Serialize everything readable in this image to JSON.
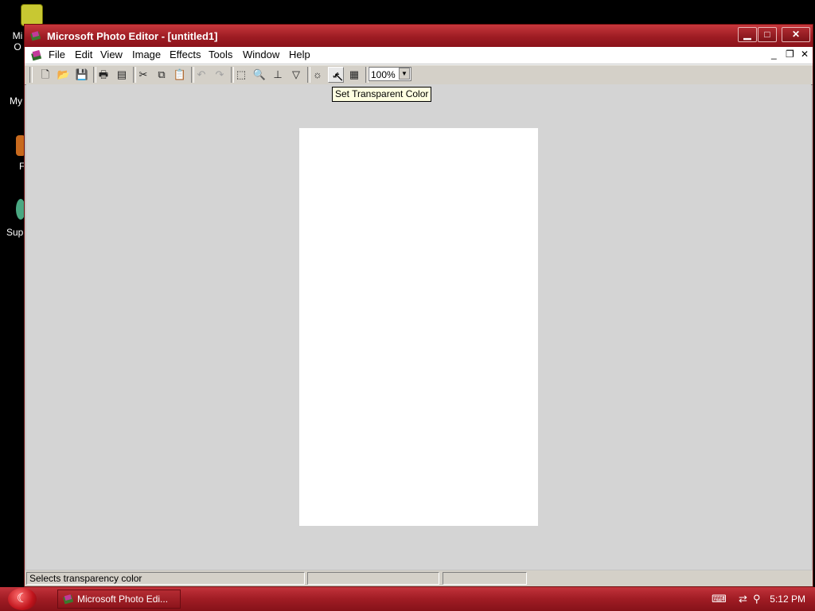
{
  "desktop": {
    "icons": [
      {
        "label": "Mi\nO",
        "name": "desktop-icon-1"
      },
      {
        "label": "My",
        "name": "desktop-icon-2"
      },
      {
        "label": "F",
        "name": "desktop-icon-3"
      },
      {
        "label": "Sup",
        "name": "desktop-icon-4"
      }
    ]
  },
  "window": {
    "title": "Microsoft Photo Editor - [untitled1]",
    "controls": {
      "minimize": "▁",
      "maximize": "□",
      "close": "✕"
    }
  },
  "menubar": {
    "items": [
      "File",
      "Edit",
      "View",
      "Image",
      "Effects",
      "Tools",
      "Window",
      "Help"
    ]
  },
  "toolbar": {
    "zoom_value": "100%",
    "zoom_arrow": "▼",
    "tooltip": "Set Transparent Color"
  },
  "status": {
    "message": "Selects transparency color"
  },
  "taskbar": {
    "start_symbol": "☾",
    "task_label": "Microsoft Photo Edi...",
    "clock": "5:12 PM"
  },
  "colors": {
    "titlebar": "#9d1c23",
    "taskbar": "#a01c24",
    "workspace": "#d4d4d4",
    "canvas": "#ffffff"
  }
}
